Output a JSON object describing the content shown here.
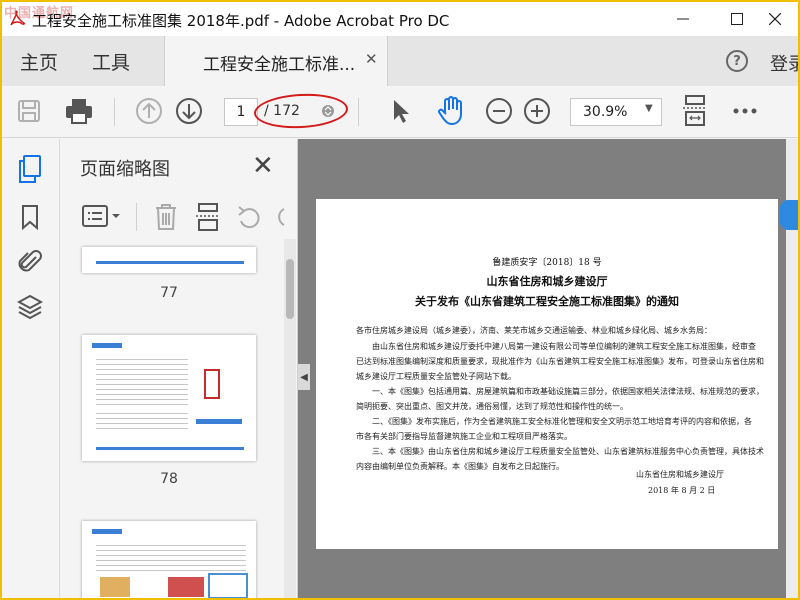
{
  "window": {
    "title": "工程安全施工标准图集 2018年.pdf - Adobe Acrobat Pro DC",
    "watermark": "中国通航网"
  },
  "menu": {
    "home": "主页",
    "tools": "工具",
    "doc_tab": "工程安全施工标准...",
    "login": "登录"
  },
  "toolbar": {
    "current_page": "1",
    "total_pages": "/ 172",
    "zoom": "30.9%"
  },
  "panel": {
    "title": "页面缩略图",
    "thumbnails": [
      {
        "label": "77"
      },
      {
        "label": "78"
      }
    ]
  },
  "document": {
    "ref": "鲁建质安字〔2018〕18 号",
    "org": "山东省住房和城乡建设厅",
    "notice_title": "关于发布《山东省建筑工程安全施工标准图集》的通知",
    "paragraphs": [
      "各市住房城乡建设局（城乡建委），济南、莱芜市城乡交通运输委、林业和城乡绿化局、城乡水务局：",
      "　　由山东省住房和城乡建设厅委托中建八局第一建设有限公司等单位编制的建筑工程安全施工标准图集，经审查",
      "已达到标准图集编制深度和质量要求，现批准作为《山东省建筑工程安全施工标准图集》发布，可登录山东省住房和",
      "城乡建设厅工程质量安全监管处子网站下载。",
      "　　一、本《图集》包括通用篇、房屋建筑篇和市政基础设施篇三部分，依据国家相关法律法规、标准规范的要求，",
      "简明扼要、突出重点、图文并茂，通俗易懂，达到了规范性和操作性的统一。",
      "　　二、《图集》发布实施后，作为全省建筑施工安全标准化管理和安全文明示范工地培育考评的内容和依据，各",
      "市各有关部门要指导监督建筑施工企业和工程项目严格落实。",
      "　　三、本《图集》由山东省住房和城乡建设厅工程质量安全监管处、山东省建筑标准服务中心负责管理，具体技术",
      "内容由编制单位负责解释。本《图集》自发布之日起施行。"
    ],
    "sign_org": "山东省住房和城乡建设厅",
    "sign_date": "2018 年 8 月 2 日"
  },
  "colors": {
    "accent_blue": "#1473e6",
    "annotation_red": "#d41a1a",
    "border_yellow": "#f0c000"
  }
}
